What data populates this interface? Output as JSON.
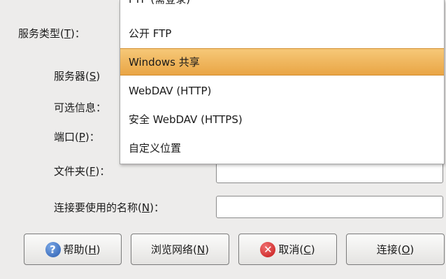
{
  "form": {
    "service_type": {
      "label": "服务类型(",
      "mnemonic": "T",
      "suffix": ")："
    },
    "server": {
      "label": "服务器(",
      "mnemonic": "S",
      "suffix": ")"
    },
    "optional_info": {
      "label": "可选信息："
    },
    "port": {
      "label": "端口(",
      "mnemonic": "P",
      "suffix": ")："
    },
    "folder": {
      "label": "文件夹(",
      "mnemonic": "F",
      "suffix": ")："
    },
    "connection_name": {
      "label": "连接要使用的名称(",
      "mnemonic": "N",
      "suffix": ")："
    }
  },
  "dropdown": {
    "items": [
      {
        "label": "FTP (需登录)"
      },
      {
        "label": "公开 FTP"
      },
      {
        "label": "Windows 共享",
        "selected": true
      },
      {
        "label": "WebDAV (HTTP)"
      },
      {
        "label": "安全 WebDAV (HTTPS)"
      },
      {
        "label": "自定义位置"
      }
    ]
  },
  "buttons": {
    "help": {
      "label": "帮助(",
      "mnemonic": "H",
      "suffix": ")",
      "icon": "help-icon"
    },
    "browse": {
      "label": "浏览网络(",
      "mnemonic": "N",
      "suffix": ")"
    },
    "cancel": {
      "label": "取消(",
      "mnemonic": "C",
      "suffix": ")",
      "icon": "cancel-icon"
    },
    "connect": {
      "label": "连接(",
      "mnemonic": "O",
      "suffix": ")"
    }
  },
  "colors": {
    "selection": "#e9a545",
    "background": "#edeceb"
  }
}
